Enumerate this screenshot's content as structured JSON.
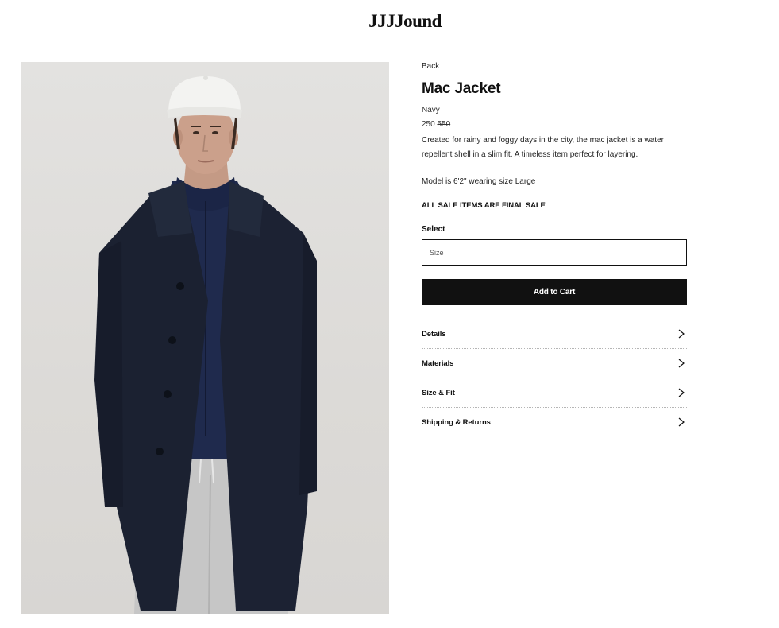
{
  "brand": {
    "logo_text": "JJJJound"
  },
  "product": {
    "back_label": "Back",
    "title": "Mac Jacket",
    "color": "Navy",
    "price_sale": "250",
    "price_original": "550",
    "description": "Created for rainy and foggy days in the city, the mac jacket is a water repellent shell in a slim fit. A timeless item perfect for layering.",
    "model_note": "Model is 6'2\" wearing size Large",
    "sale_notice": "ALL SALE ITEMS ARE FINAL SALE",
    "select_label": "Select",
    "size_placeholder": "Size",
    "add_to_cart_label": "Add to Cart"
  },
  "accordion": {
    "items": [
      {
        "label": "Details",
        "icon": "chevron-right-icon"
      },
      {
        "label": "Materials",
        "icon": "chevron-right-icon"
      },
      {
        "label": "Size & Fit",
        "icon": "chevron-right-icon"
      },
      {
        "label": "Shipping & Returns",
        "icon": "chevron-right-icon"
      }
    ]
  },
  "colors": {
    "background": "#ffffff",
    "text": "#111111",
    "button_bg": "#111111",
    "button_text": "#ffffff",
    "photo_bg": "#dedcd9",
    "coat": "#1c2233",
    "sweater": "#1f2a4d",
    "cap": "#f4f4f2",
    "pants": "#c9c9c9"
  }
}
